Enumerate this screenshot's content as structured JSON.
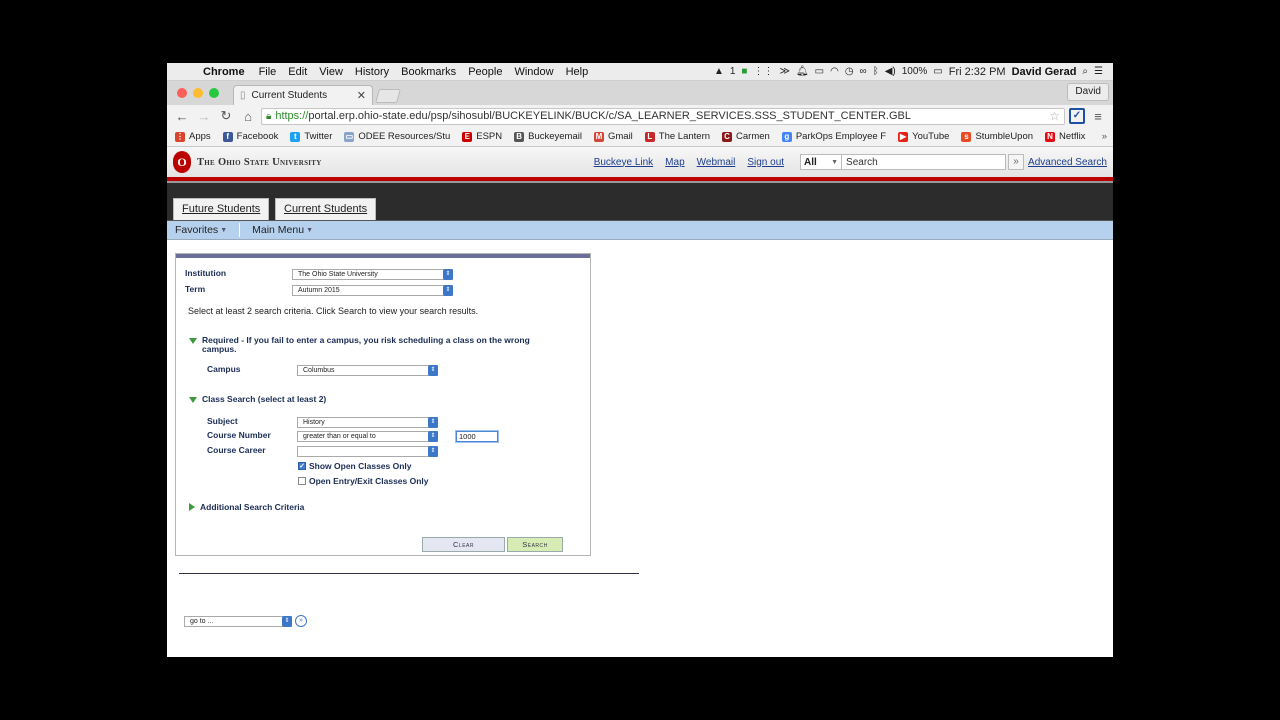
{
  "menubar": {
    "app": "Chrome",
    "items": [
      "File",
      "Edit",
      "View",
      "History",
      "Bookmarks",
      "People",
      "Window",
      "Help"
    ],
    "status": {
      "notif_count": "1",
      "battery": "100%",
      "clock": "Fri 2:32 PM",
      "user": "David Gerad"
    }
  },
  "browser": {
    "tab_title": "Current Students",
    "profile": "David",
    "url_secure": "https://",
    "url_rest": "portal.erp.ohio-state.edu/psp/sihosubl/BUCKEYELINK/BUCK/c/SA_LEARNER_SERVICES.SSS_STUDENT_CENTER.GBL",
    "bookmarks": [
      {
        "label": "Apps",
        "color": "#d9452c",
        "glyph": "⋮"
      },
      {
        "label": "Facebook",
        "color": "#3b5998",
        "glyph": "f"
      },
      {
        "label": "Twitter",
        "color": "#1da1f2",
        "glyph": "t"
      },
      {
        "label": "ODEE Resources/Stu",
        "color": "#8aa4c8",
        "glyph": "▭"
      },
      {
        "label": "ESPN",
        "color": "#cc0000",
        "glyph": "E"
      },
      {
        "label": "Buckeyemail",
        "color": "#555555",
        "glyph": "B"
      },
      {
        "label": "Gmail",
        "color": "#d44638",
        "glyph": "M"
      },
      {
        "label": "The Lantern",
        "color": "#c62828",
        "glyph": "L"
      },
      {
        "label": "Carmen",
        "color": "#8b1a1a",
        "glyph": "C"
      },
      {
        "label": "ParkOps Employee F",
        "color": "#4285f4",
        "glyph": "g"
      },
      {
        "label": "YouTube",
        "color": "#e62117",
        "glyph": "▶"
      },
      {
        "label": "StumbleUpon",
        "color": "#eb4924",
        "glyph": "s"
      },
      {
        "label": "Netflix",
        "color": "#e50914",
        "glyph": "N"
      }
    ]
  },
  "osu": {
    "logo_letter": "O",
    "name": "The Ohio State University",
    "links": [
      "Buckeye Link",
      "Map",
      "Webmail",
      "Sign out"
    ],
    "search_scope": "All",
    "search_placeholder": "Search",
    "advanced": "Advanced Search"
  },
  "portal_tabs": [
    "Future Students",
    "Current Students"
  ],
  "nav": {
    "favorites": "Favorites",
    "main_menu": "Main Menu"
  },
  "form": {
    "institution_label": "Institution",
    "institution_value": "The Ohio State University",
    "term_label": "Term",
    "term_value": "Autumn 2015",
    "instructions": "Select at least 2 search criteria. Click Search to view your search results.",
    "required_header": "Required - If you fail to enter a campus, you risk scheduling a class on the wrong campus.",
    "campus_label": "Campus",
    "campus_value": "Columbus",
    "class_search_header": "Class Search (select at least 2)",
    "subject_label": "Subject",
    "subject_value": "History",
    "course_number_label": "Course Number",
    "course_number_op": "greater than or equal to",
    "course_number_value": "1000",
    "course_career_label": "Course Career",
    "course_career_value": "",
    "show_open_label": "Show Open Classes Only",
    "show_open_checked": true,
    "open_entry_label": "Open Entry/Exit Classes Only",
    "open_entry_checked": false,
    "additional_header": "Additional Search Criteria",
    "clear_label": "Clear",
    "search_label": "Search",
    "goto_value": "go to ..."
  },
  "colors": {
    "osu_red": "#bb0000",
    "nav_blue": "#b6d1ee",
    "link_blue": "#1d3d8f",
    "search_btn": "#d7ecb5",
    "clear_btn": "#e4e6f2"
  }
}
